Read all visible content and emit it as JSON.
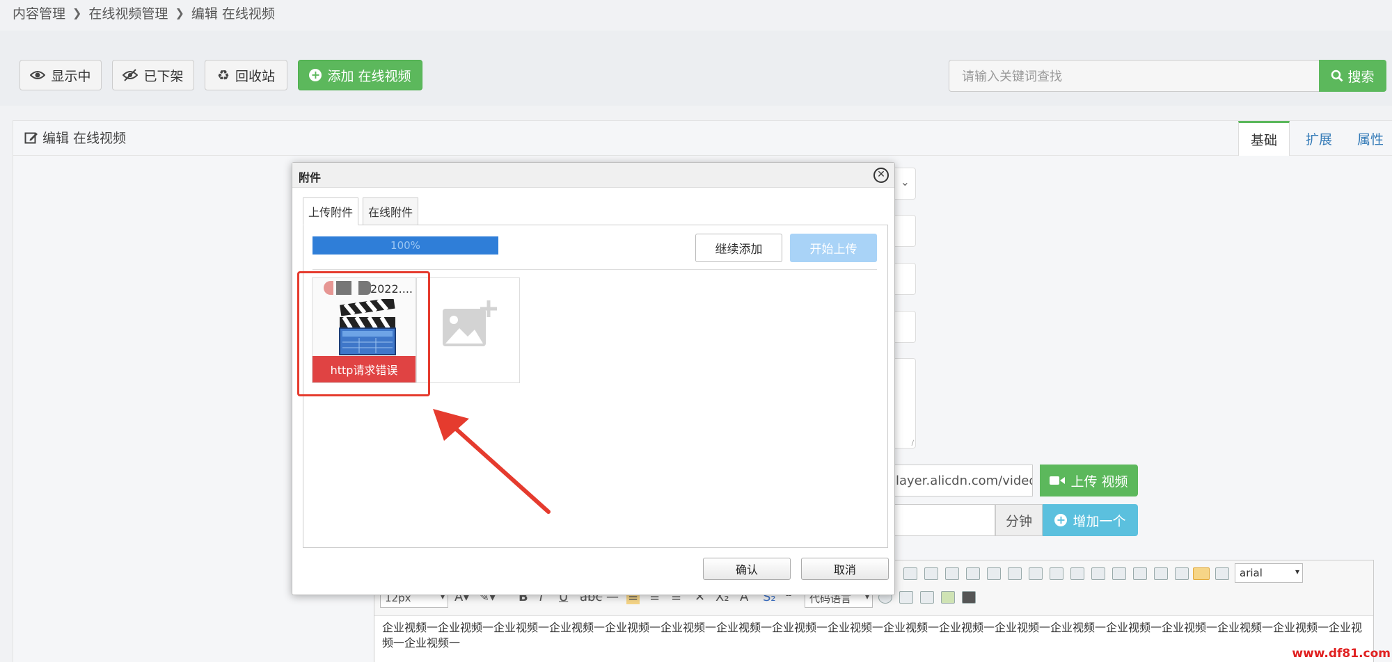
{
  "breadcrumb": [
    "内容管理",
    "在线视频管理",
    "编辑 在线视频"
  ],
  "toolbar": {
    "showing_label": "显示中",
    "offline_label": "已下架",
    "recycle_label": "回收站",
    "add_label": "添加 在线视频",
    "search_placeholder": "请输入关键词查找",
    "search_label": "搜索"
  },
  "panel": {
    "title": "编辑 在线视频",
    "tabs": [
      "基础",
      "扩展",
      "属性"
    ]
  },
  "form": {
    "video_url_value": "layer.alicdn.com/video/e",
    "upload_video_label": "上传 视频",
    "minute_label": "分钟",
    "add_one_label": "增加一个"
  },
  "editor": {
    "font_size": "12px",
    "code_language": "代码语言",
    "font_family": "arial",
    "content": "企业视频一企业视频一企业视频一企业视频一企业视频一企业视频一企业视频一企业视频一企业视频一企业视频一企业视频一企业视频一企业视频一企业视频一企业视频一企业视频一企业视频一企业视频一企业视频一"
  },
  "dialog": {
    "title": "附件",
    "tabs": [
      "上传附件",
      "在线附件"
    ],
    "progress": "100%",
    "progress_fraction": 1.0,
    "continue_label": "继续添加",
    "start_label": "开始上传",
    "file_name": "2022....",
    "error_text": "http请求错误",
    "confirm_label": "确认",
    "cancel_label": "取消"
  },
  "watermark": "www.df81.com",
  "colors": {
    "green": "#5cb85c",
    "info": "#5bc0de",
    "progress_blue": "#2f7ed8",
    "error_red": "#e04343",
    "annotation_red": "#e53b2e"
  }
}
